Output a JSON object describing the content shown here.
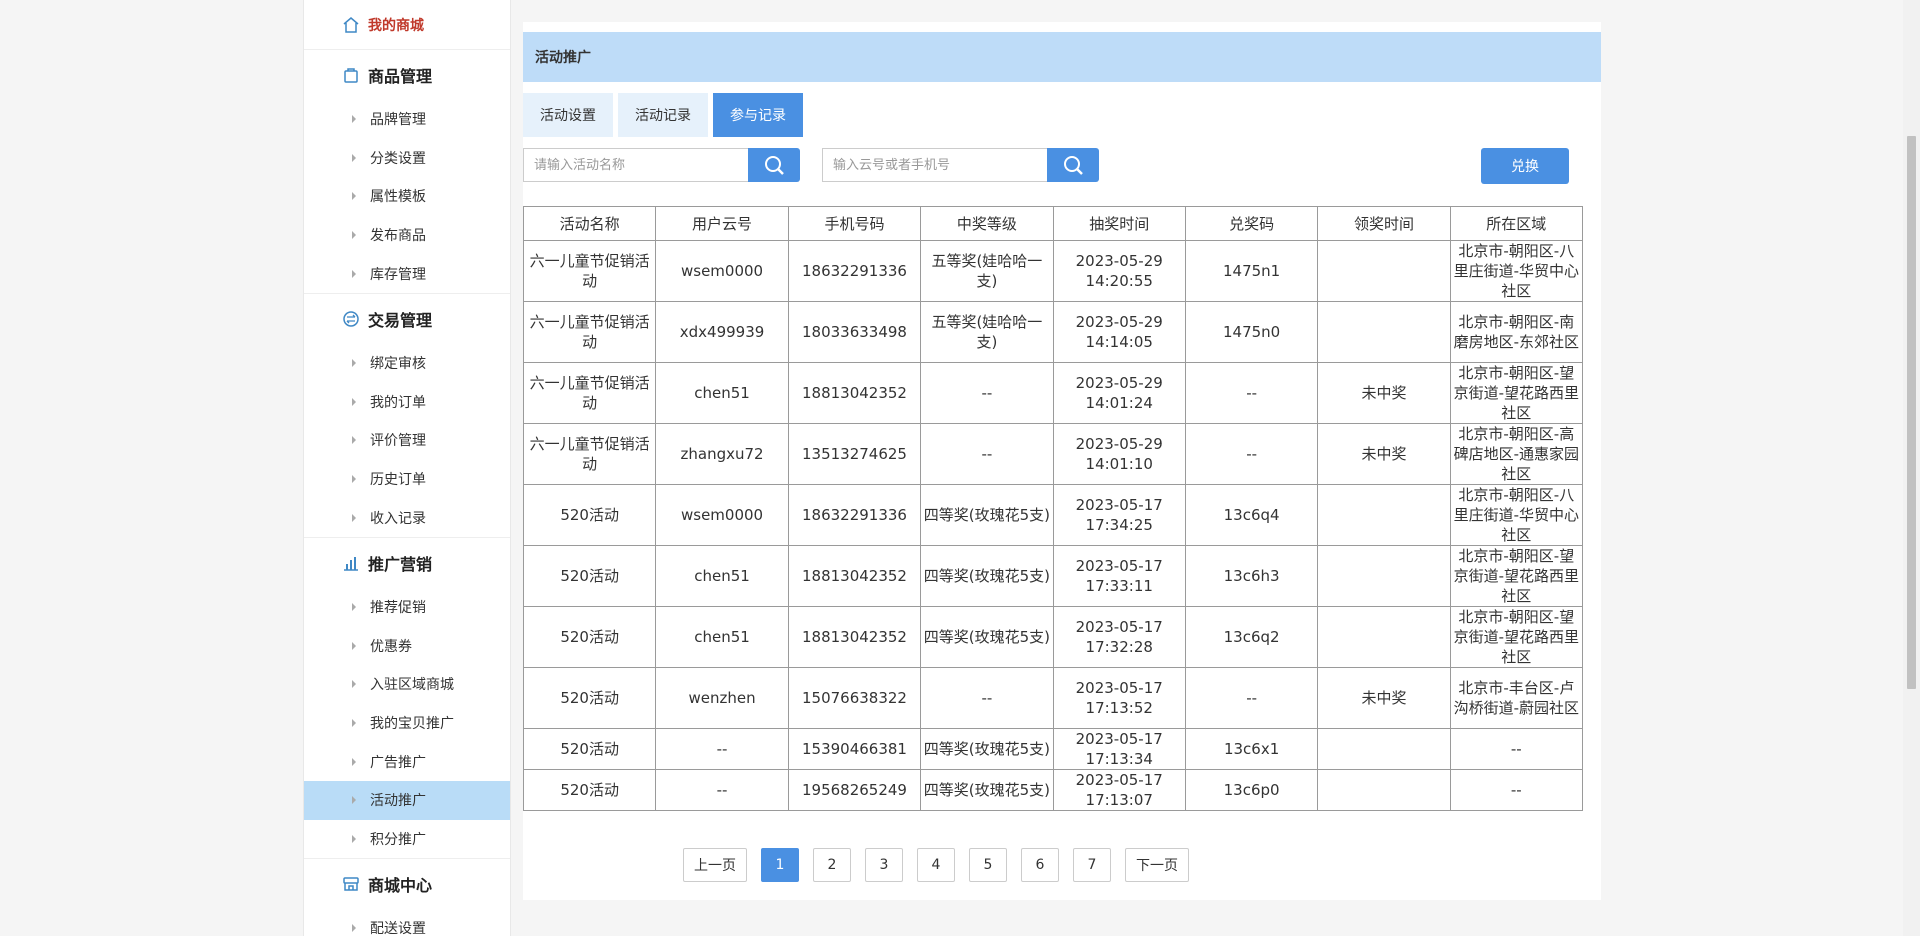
{
  "sidebar": {
    "top": {
      "label": "我的商城",
      "icon": "home-icon"
    },
    "groups": [
      {
        "title": "商品管理",
        "icon": "bag-icon",
        "items": [
          "品牌管理",
          "分类设置",
          "属性模板",
          "发布商品",
          "库存管理"
        ]
      },
      {
        "title": "交易管理",
        "icon": "exchange-icon",
        "items": [
          "绑定审核",
          "我的订单",
          "评价管理",
          "历史订单",
          "收入记录"
        ]
      },
      {
        "title": "推广营销",
        "icon": "chart-icon",
        "items": [
          "推荐促销",
          "优惠券",
          "入驻区域商城",
          "我的宝贝推广",
          "广告推广",
          "活动推广",
          "积分推广"
        ]
      },
      {
        "title": "商城中心",
        "icon": "store-icon",
        "items": [
          "配送设置"
        ]
      }
    ],
    "active_item": "活动推广"
  },
  "banner": {
    "title": "活动推广"
  },
  "tabs": [
    "活动设置",
    "活动记录",
    "参与记录"
  ],
  "active_tab": "参与记录",
  "search1": {
    "placeholder": "请输入活动名称"
  },
  "search2": {
    "placeholder": "输入云号或者手机号"
  },
  "exchange_label": "兑换",
  "table": {
    "headers": [
      "活动名称",
      "用户云号",
      "手机号码",
      "中奖等级",
      "抽奖时间",
      "兑奖码",
      "领奖时间",
      "所在区域"
    ],
    "rows": [
      [
        "六一儿童节促销活动",
        "wsem0000",
        "18632291336",
        "五等奖(娃哈哈一支)",
        "2023-05-29 14:20:55",
        "1475n1",
        "",
        "北京市-朝阳区-八里庄街道-华贸中心社区"
      ],
      [
        "六一儿童节促销活动",
        "xdx499939",
        "18033633498",
        "五等奖(娃哈哈一支)",
        "2023-05-29 14:14:05",
        "1475n0",
        "",
        "北京市-朝阳区-南磨房地区-东郊社区"
      ],
      [
        "六一儿童节促销活动",
        "chen51",
        "18813042352",
        "--",
        "2023-05-29 14:01:24",
        "--",
        "未中奖",
        "北京市-朝阳区-望京街道-望花路西里社区"
      ],
      [
        "六一儿童节促销活动",
        "zhangxu72",
        "13513274625",
        "--",
        "2023-05-29 14:01:10",
        "--",
        "未中奖",
        "北京市-朝阳区-高碑店地区-通惠家园社区"
      ],
      [
        "520活动",
        "wsem0000",
        "18632291336",
        "四等奖(玫瑰花5支)",
        "2023-05-17 17:34:25",
        "13c6q4",
        "",
        "北京市-朝阳区-八里庄街道-华贸中心社区"
      ],
      [
        "520活动",
        "chen51",
        "18813042352",
        "四等奖(玫瑰花5支)",
        "2023-05-17 17:33:11",
        "13c6h3",
        "",
        "北京市-朝阳区-望京街道-望花路西里社区"
      ],
      [
        "520活动",
        "chen51",
        "18813042352",
        "四等奖(玫瑰花5支)",
        "2023-05-17 17:32:28",
        "13c6q2",
        "",
        "北京市-朝阳区-望京街道-望花路西里社区"
      ],
      [
        "520活动",
        "wenzhen",
        "15076638322",
        "--",
        "2023-05-17 17:13:52",
        "--",
        "未中奖",
        "北京市-丰台区-卢沟桥街道-蔚园社区"
      ],
      [
        "520活动",
        "--",
        "15390466381",
        "四等奖(玫瑰花5支)",
        "2023-05-17 17:13:34",
        "13c6x1",
        "",
        "--"
      ],
      [
        "520活动",
        "--",
        "19568265249",
        "四等奖(玫瑰花5支)",
        "2023-05-17 17:13:07",
        "13c6p0",
        "",
        "--"
      ]
    ]
  },
  "pager": {
    "prev": "上一页",
    "next": "下一页",
    "pages": [
      "1",
      "2",
      "3",
      "4",
      "5",
      "6",
      "7"
    ],
    "current": "1"
  },
  "colors": {
    "accent": "#4a90e2",
    "banner": "#bedcf8",
    "active_sidebar": "#b9dcf7",
    "top_link": "#c0392b"
  }
}
